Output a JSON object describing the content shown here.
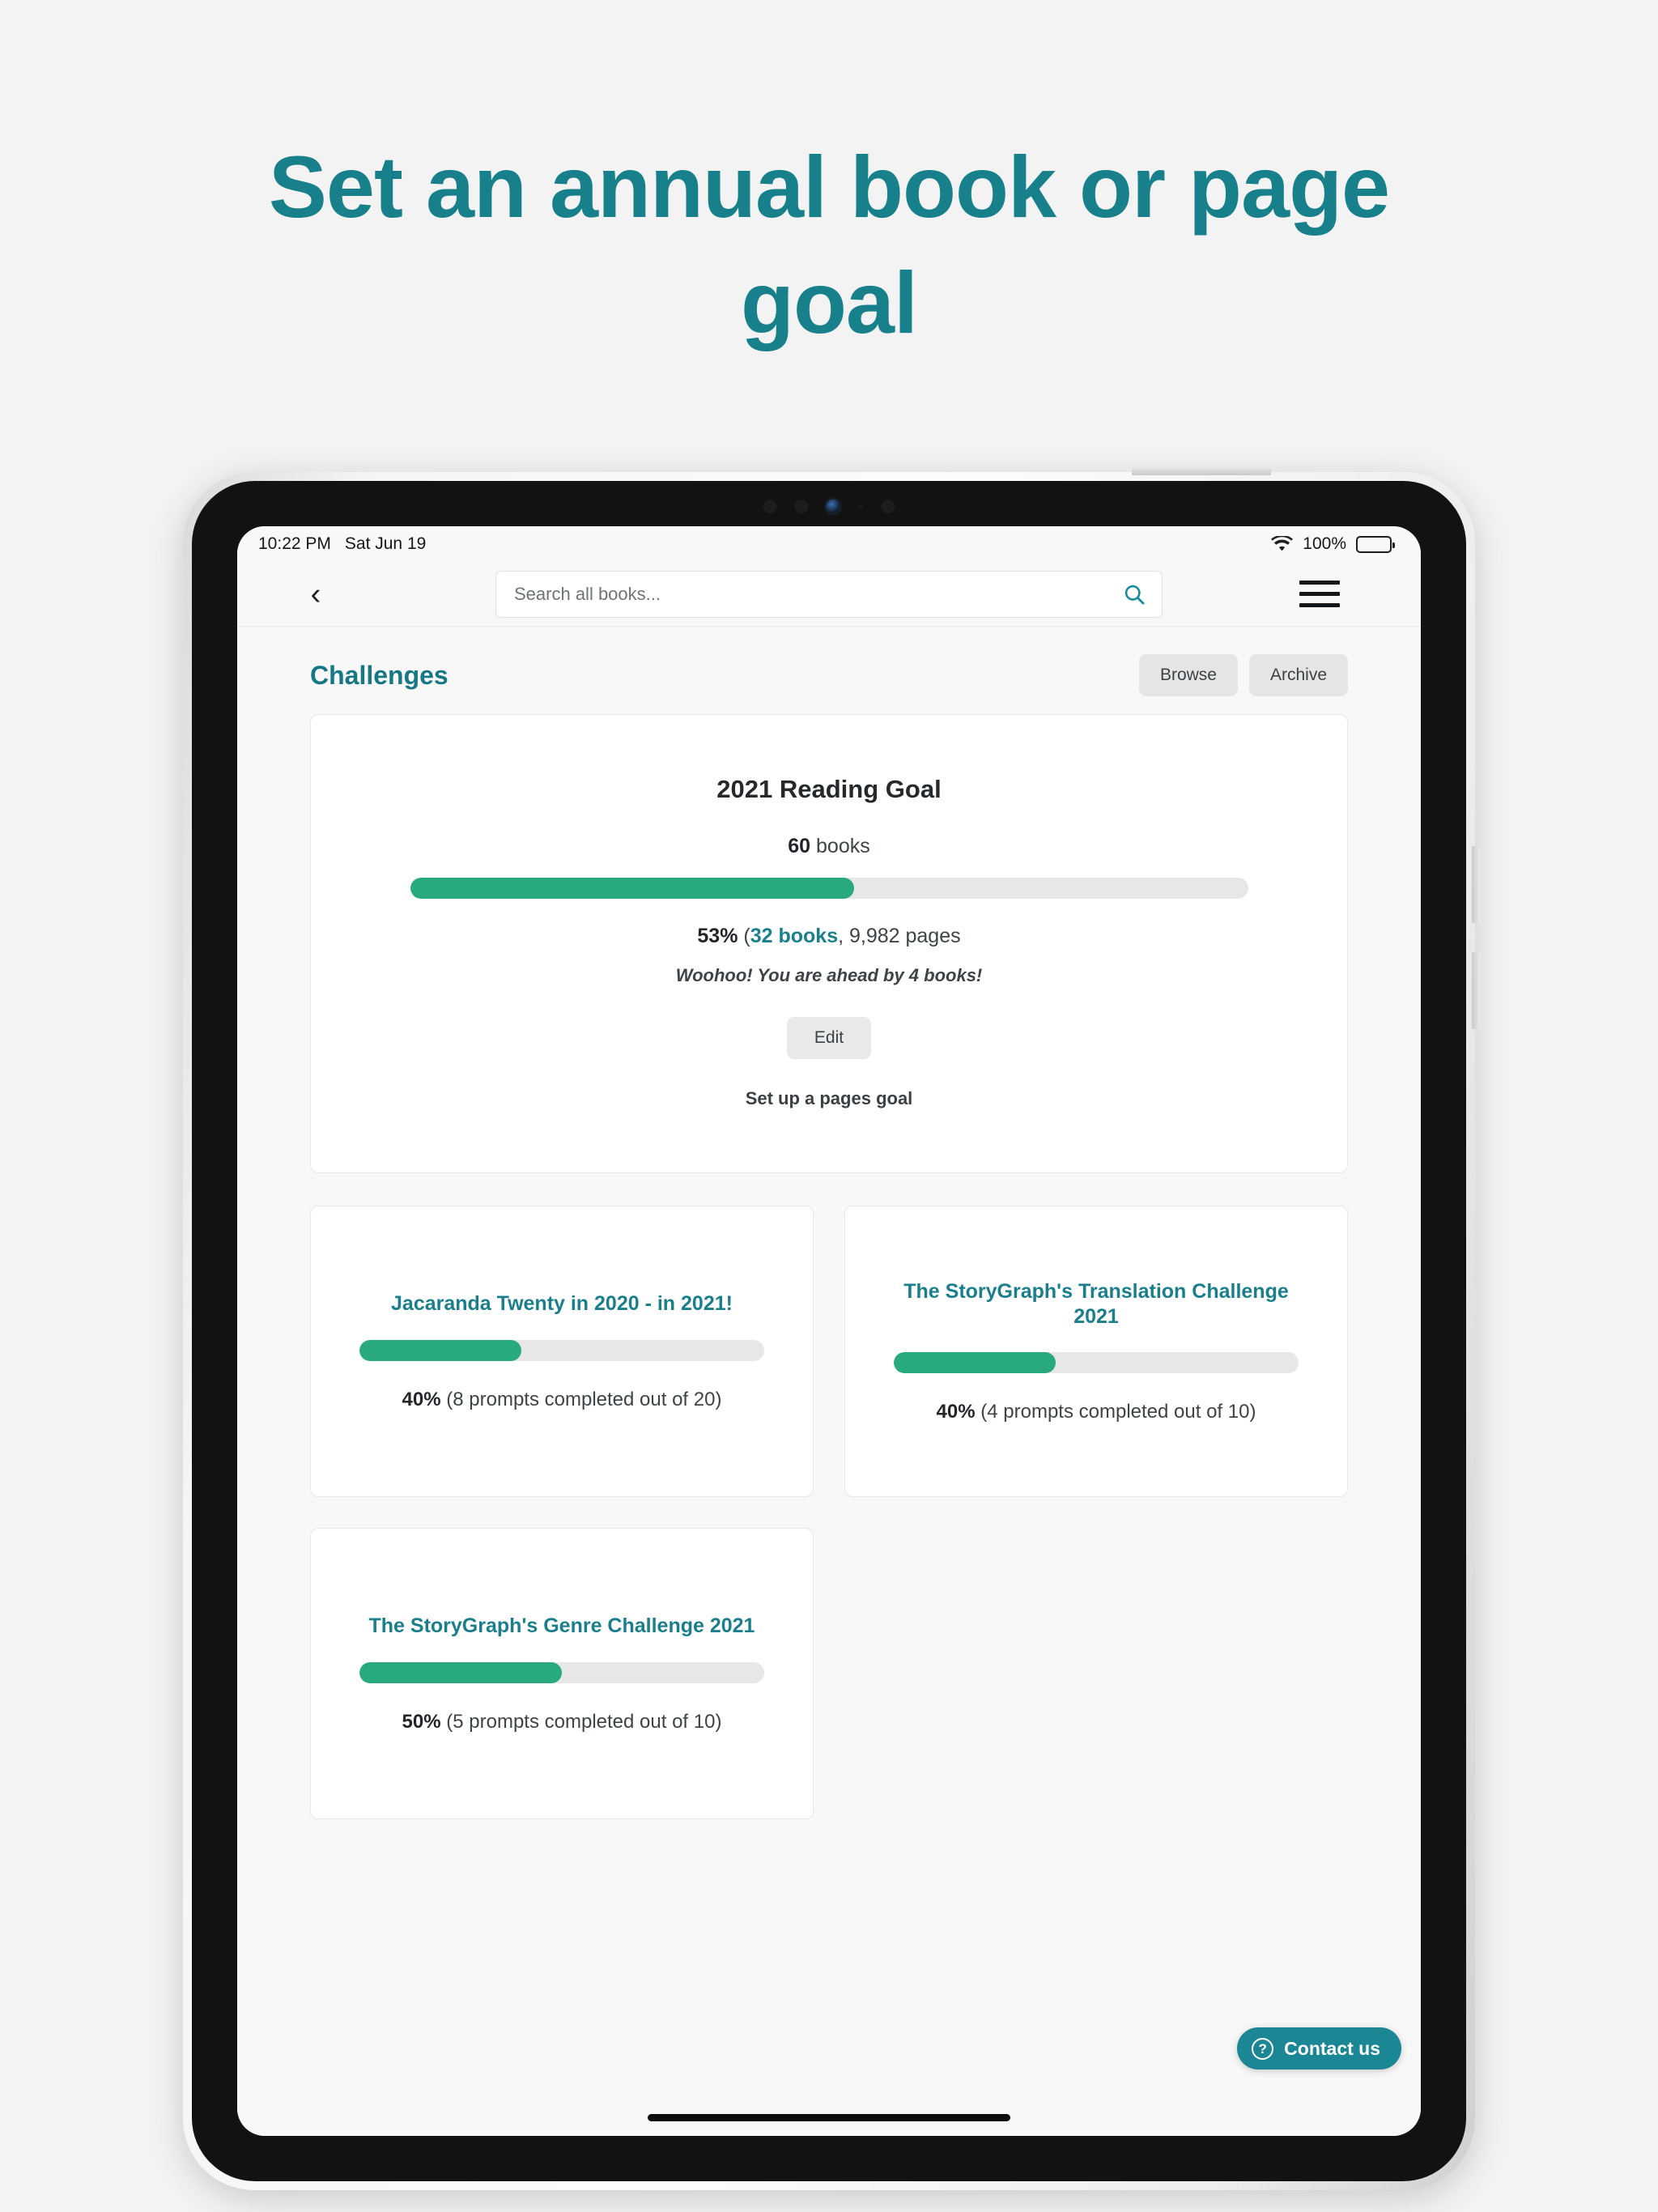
{
  "promo": {
    "headline": "Set an annual book or page goal",
    "accent_color": "#17808b"
  },
  "status_bar": {
    "time": "10:22 PM",
    "date": "Sat Jun 19",
    "battery_percent": "100%",
    "wifi_icon": "wifi-icon",
    "battery_icon": "battery-full-icon"
  },
  "nav": {
    "back_icon": "chevron-left-icon",
    "search_placeholder": "Search all books...",
    "search_value": "",
    "search_icon": "search-icon",
    "menu_icon": "hamburger-menu-icon"
  },
  "header": {
    "title": "Challenges",
    "browse_label": "Browse",
    "archive_label": "Archive"
  },
  "reading_goal": {
    "title": "2021 Reading Goal",
    "goal_number": "60",
    "goal_unit": "books",
    "percent_label": "53%",
    "percent_value": 53,
    "books_link": "32 books",
    "pages_text": ", 9,982 pages",
    "message": "Woohoo! You are ahead by 4 books!",
    "edit_label": "Edit",
    "pages_goal_link": "Set up a pages goal",
    "bar_color": "#29a97e",
    "track_color": "#e6e7e6"
  },
  "challenges": [
    {
      "title": "Jacaranda Twenty in 2020 - in 2021!",
      "percent_label": "40%",
      "percent_value": 40,
      "detail": " (8 prompts completed out of 20)"
    },
    {
      "title": "The StoryGraph's Translation Challenge 2021",
      "percent_label": "40%",
      "percent_value": 40,
      "detail": " (4 prompts completed out of 10)"
    },
    {
      "title": "The StoryGraph's Genre Challenge 2021",
      "percent_label": "50%",
      "percent_value": 50,
      "detail": " (5 prompts completed out of 10)"
    }
  ],
  "contact_widget": {
    "label": "Contact us",
    "icon": "question-mark-circle-icon",
    "color": "#1b8794"
  }
}
